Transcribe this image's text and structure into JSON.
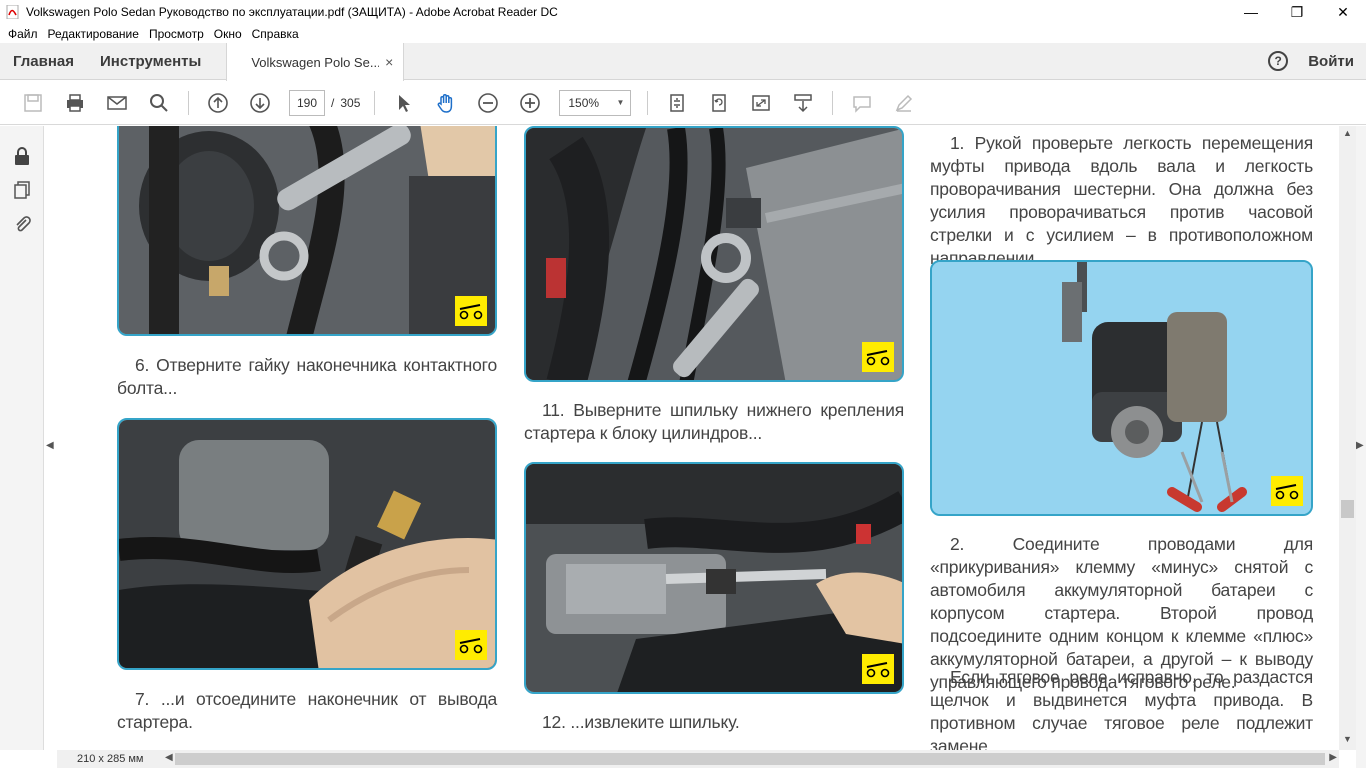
{
  "window": {
    "title": "Volkswagen Polo Sedan Руководство по эксплуатации.pdf (ЗАЩИТА) - Adobe Acrobat Reader DC"
  },
  "menu": [
    "Файл",
    "Редактирование",
    "Просмотр",
    "Окно",
    "Справка"
  ],
  "tabs": {
    "home": "Главная",
    "tools": "Инструменты",
    "document": "Volkswagen Polo Se...",
    "close": "×",
    "help": "?",
    "signin": "Войти"
  },
  "toolbar": {
    "page_current": "190",
    "page_separator": "/",
    "page_total": "305",
    "zoom": "150%"
  },
  "status": {
    "page_size": "210 x 285 мм"
  },
  "captions": {
    "c6": "6. Отверните гайку наконечника контактного болта...",
    "c7": "7. ...и отсоедините наконечник от вывода стартера.",
    "c11": "11. Выверните шпильку нижнего крепления стартера к блоку цилиндров...",
    "c12": "12. ...извлеките шпильку.",
    "r1": "1. Рукой проверьте легкость перемещения муфты привода вдоль вала и легкость проворачивания шестерни. Она должна без усилия проворачиваться против часовой стрелки и с усилием – в противоположном направлении.",
    "r2": "2. Соедините проводами для «прикуривания» клемму «минус» снятой с автомобиля аккумуляторной батареи с корпусом стартера. Второй провод подсоедините одним концом к клемме «плюс» аккумуляторной батареи, а другой – к выводу управляющего провода тягового реле.",
    "r3": "Если тяговое реле исправно, то раздастся щелчок и выдвинется муфта привода. В противном случае тяговое реле подлежит замене."
  },
  "colors": {
    "photo_border": "#35a4c8",
    "badge": "#ffec00",
    "caption_text": "#444444"
  }
}
